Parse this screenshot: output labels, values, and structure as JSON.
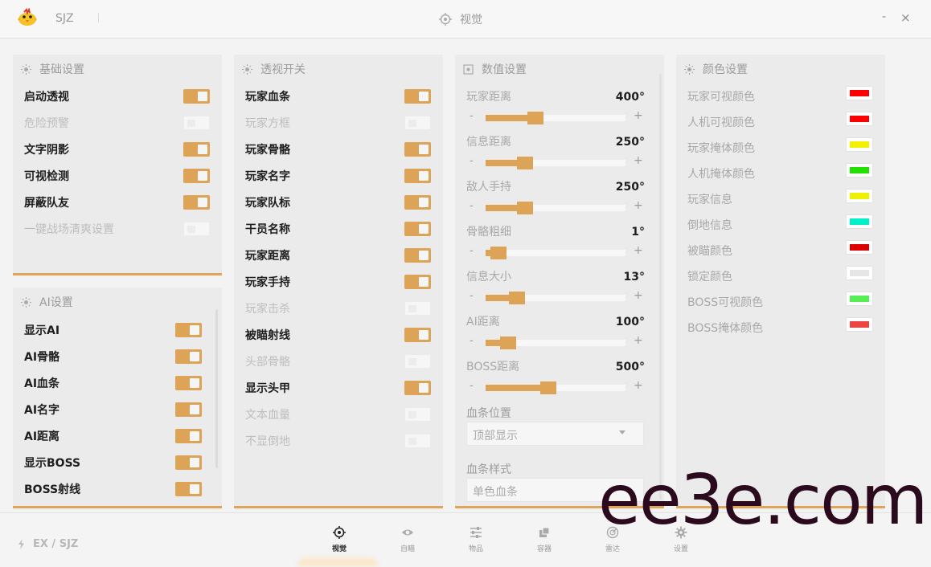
{
  "app": {
    "title": "SJZ",
    "view_title": "视觉",
    "minimize": "-",
    "close": "×",
    "logo_icon": "chick-logo"
  },
  "panels": {
    "basic": {
      "title": "基础设置",
      "items": [
        {
          "label": "启动透视",
          "on": true
        },
        {
          "label": "危险预警",
          "on": false
        },
        {
          "label": "文字阴影",
          "on": true
        },
        {
          "label": "可视检测",
          "on": true
        },
        {
          "label": "屏蔽队友",
          "on": true
        },
        {
          "label": "一键战场清爽设置",
          "on": false
        }
      ]
    },
    "ai": {
      "title": "AI设置",
      "items": [
        {
          "label": "显示AI",
          "on": true
        },
        {
          "label": "AI骨骼",
          "on": true
        },
        {
          "label": "AI血条",
          "on": true
        },
        {
          "label": "AI名字",
          "on": true
        },
        {
          "label": "AI距离",
          "on": true
        },
        {
          "label": "显示BOSS",
          "on": true
        },
        {
          "label": "BOSS射线",
          "on": true
        }
      ]
    },
    "esp": {
      "title": "透视开关",
      "items": [
        {
          "label": "玩家血条",
          "on": true
        },
        {
          "label": "玩家方框",
          "on": false
        },
        {
          "label": "玩家骨骼",
          "on": true
        },
        {
          "label": "玩家名字",
          "on": true
        },
        {
          "label": "玩家队标",
          "on": true
        },
        {
          "label": "干员名称",
          "on": true
        },
        {
          "label": "玩家距离",
          "on": true
        },
        {
          "label": "玩家手持",
          "on": true
        },
        {
          "label": "玩家击杀",
          "on": false
        },
        {
          "label": "被瞄射线",
          "on": true
        },
        {
          "label": "头部骨骼",
          "on": false
        },
        {
          "label": "显示头甲",
          "on": true
        },
        {
          "label": "文本血量",
          "on": false
        },
        {
          "label": "不显倒地",
          "on": false
        }
      ]
    },
    "values": {
      "title": "数值设置",
      "sliders": [
        {
          "label": "玩家距离",
          "value": "400°",
          "minus": "-",
          "plus": "+",
          "level": 0.34
        },
        {
          "label": "信息距离",
          "value": "250°",
          "minus": "-",
          "plus": "+",
          "level": 0.25
        },
        {
          "label": "敌人手持",
          "value": "250°",
          "minus": "-",
          "plus": "+",
          "level": 0.25
        },
        {
          "label": "骨骼粗细",
          "value": "1°",
          "minus": "-",
          "plus": "+",
          "level": 0.04
        },
        {
          "label": "信息大小",
          "value": "13°",
          "minus": "-",
          "plus": "+",
          "level": 0.19
        },
        {
          "label": "AI距离",
          "value": "100°",
          "minus": "-",
          "plus": "+",
          "level": 0.12
        },
        {
          "label": "BOSS距离",
          "value": "500°",
          "minus": "-",
          "plus": "+",
          "level": 0.44
        }
      ],
      "healthbar_position": {
        "label": "血条位置",
        "value": "顶部显示"
      },
      "healthbar_style": {
        "label": "血条样式",
        "value": "单色血条"
      }
    },
    "colors": {
      "title": "颜色设置",
      "items": [
        {
          "label": "玩家可视颜色",
          "color": "#ff0000"
        },
        {
          "label": "人机可视颜色",
          "color": "#ff0000"
        },
        {
          "label": "玩家掩体颜色",
          "color": "#f2f200"
        },
        {
          "label": "人机掩体颜色",
          "color": "#22e000"
        },
        {
          "label": "玩家信息",
          "color": "#eef200"
        },
        {
          "label": "倒地信息",
          "color": "#00f0c8"
        },
        {
          "label": "被瞄颜色",
          "color": "#dd0000"
        },
        {
          "label": "锁定颜色",
          "color": "#e6e6e6"
        },
        {
          "label": "BOSS可视颜色",
          "color": "#55ee55"
        },
        {
          "label": "BOSS掩体颜色",
          "color": "#ee4444"
        }
      ]
    }
  },
  "footer": {
    "brand": "EX / SJZ"
  },
  "nav": [
    {
      "label": "视觉",
      "icon": "crosshair-icon",
      "active": true
    },
    {
      "label": "自瞄",
      "icon": "eye-icon",
      "active": false
    },
    {
      "label": "物品",
      "icon": "sliders-icon",
      "active": false
    },
    {
      "label": "容器",
      "icon": "boxes-icon",
      "active": false
    },
    {
      "label": "雷达",
      "icon": "radar-icon",
      "active": false
    },
    {
      "label": "设置",
      "icon": "gear-icon",
      "active": false
    }
  ],
  "watermark": "ee3e.com",
  "colors": {
    "accent": "#dda356",
    "panel": "#ebebeb",
    "background": "#f3f3f3"
  }
}
